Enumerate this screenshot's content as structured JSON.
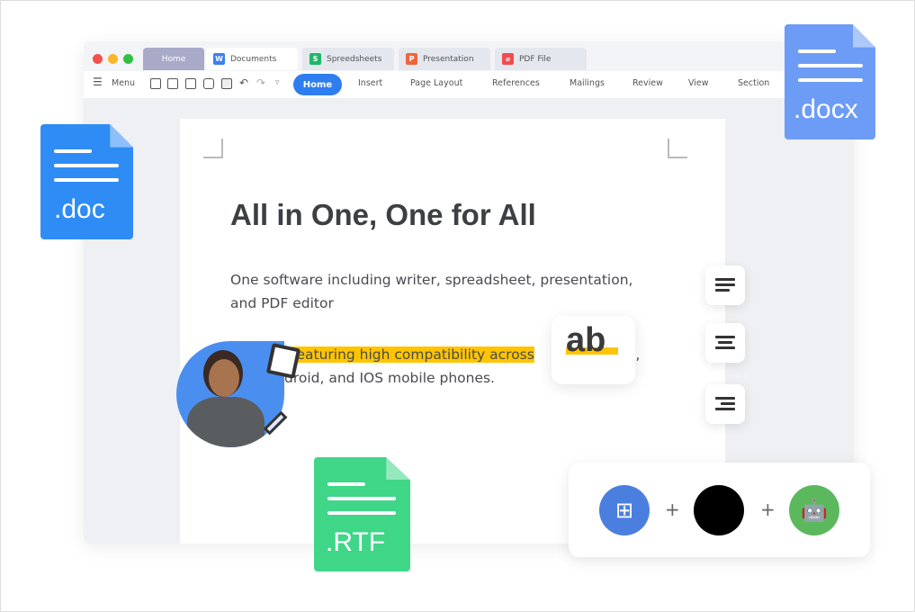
{
  "tabs": [
    {
      "label": "Home"
    },
    {
      "label": "Documents",
      "icon": "W"
    },
    {
      "label": "Spreedsheets",
      "icon": "S"
    },
    {
      "label": "Presentation",
      "icon": "P"
    },
    {
      "label": "PDF File",
      "icon": "pdf-icon"
    }
  ],
  "toolbar": {
    "menu": "Menu",
    "items": [
      "Home",
      "Insert",
      "Page Layout",
      "References",
      "Mailings",
      "Review",
      "View",
      "Section"
    ]
  },
  "doc": {
    "title": "All in One, One for All",
    "para1": "One software including writer, spreadsheet, presentation, and PDF editor",
    "para2_highlight": "featuring high compatibility across",
    "para2_tail": "c,",
    "para2_line2": "droid, and IOS mobile phones."
  },
  "badge": "ab",
  "files": {
    "doc": ".doc",
    "docx": ".docx",
    "rtf": ".RTF"
  },
  "platforms": {
    "icons": [
      "windows-icon",
      "apple-icon",
      "android-icon"
    ],
    "plus": "+"
  },
  "colors": {
    "accent": "#2f7ef0",
    "highlight": "#ffc400",
    "doc": "#2f8cf5",
    "docx": "#6d9cf6",
    "rtf": "#3fd688"
  }
}
